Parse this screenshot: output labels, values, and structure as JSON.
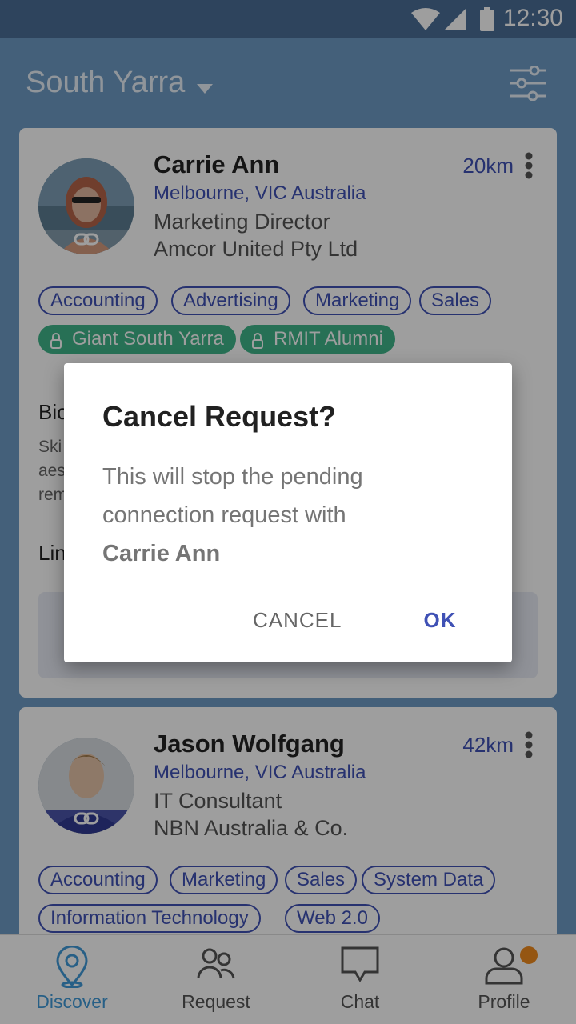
{
  "status_bar": {
    "time": "12:30",
    "icons": [
      "wifi-icon",
      "signal-icon",
      "battery-icon"
    ]
  },
  "header": {
    "location": "South Yarra",
    "filter_icon": "filter-sliders-icon"
  },
  "cards": [
    {
      "name": "Carrie Ann",
      "city": "Melbourne, VIC Australia",
      "role": "Marketing Director",
      "company": "Amcor United Pty Ltd",
      "distance": "20km",
      "tags": [
        "Accounting",
        "Advertising",
        "Marketing",
        "Sales"
      ],
      "groups": [
        "Giant South Yarra",
        "RMIT Alumni"
      ],
      "bio_label": "Bio",
      "bio_text_fragments": [
        "Ski",
        "aes",
        "rem"
      ],
      "lin_label": "Lin"
    },
    {
      "name": "Jason Wolfgang",
      "city": "Melbourne, VIC Australia",
      "role": "IT Consultant",
      "company": "NBN Australia & Co.",
      "distance": "42km",
      "tags": [
        "Accounting",
        "Marketing",
        "Sales",
        "System Data",
        "Information Technology",
        "Web 2.0"
      ]
    }
  ],
  "dialog": {
    "title": "Cancel Request?",
    "body_line1": "This will stop the pending",
    "body_line2": "connection request with",
    "body_name": "Carrie Ann",
    "cancel_label": "CANCEL",
    "ok_label": "OK"
  },
  "bottom_nav": [
    {
      "label": "Discover",
      "icon": "location-pin-icon",
      "active": true
    },
    {
      "label": "Request",
      "icon": "people-icon",
      "active": false
    },
    {
      "label": "Chat",
      "icon": "chat-bubble-icon",
      "active": false
    },
    {
      "label": "Profile",
      "icon": "person-icon",
      "active": false,
      "badge": true
    }
  ],
  "colors": {
    "accent": "#3f51b5",
    "active_nav": "#3f9ad8",
    "group_tag": "#3fb58a",
    "badge": "#f08c1e"
  }
}
